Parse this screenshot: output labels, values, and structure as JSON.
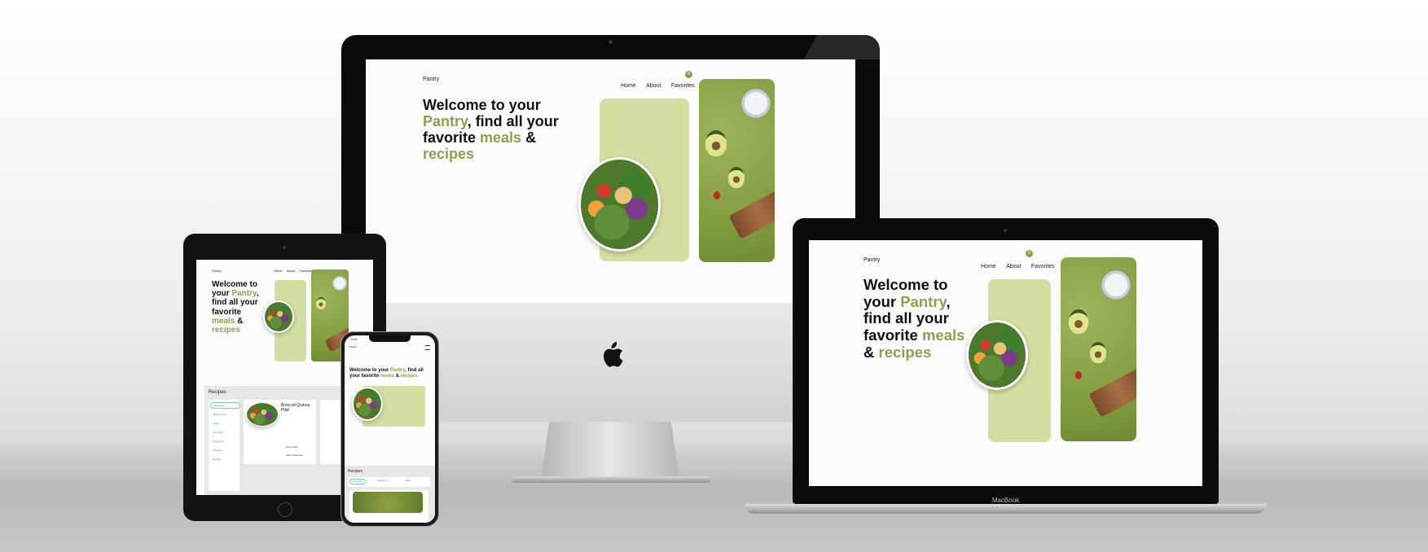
{
  "site": {
    "brand": "Pantry",
    "nav": [
      "Home",
      "About",
      "Favorites"
    ],
    "fav_count": "0",
    "hero": {
      "line_a": "Welcome to your",
      "pantry": "Pantry",
      "line_b": ", find all your favorite ",
      "meals": "meals",
      "amp": " & ",
      "recipes": "recipes"
    },
    "recipes_heading": "Recipes",
    "categories": [
      "Vegetarian",
      "Gluten Free",
      "Vegan",
      "Low Carb",
      "Ketogenic",
      "Trending",
      "Popular"
    ],
    "recipe_card": {
      "title": "Broccoli Quinoa Pilaf",
      "see_recipe": "See recipe",
      "add_favorite": "Add to favorites"
    }
  },
  "devices": {
    "laptop_label": "MacBook",
    "phone_time": "9:41"
  },
  "colors": {
    "accent": "#8f9f51",
    "panel": "#d3dea1",
    "photo_bg": "#8aa34a"
  }
}
